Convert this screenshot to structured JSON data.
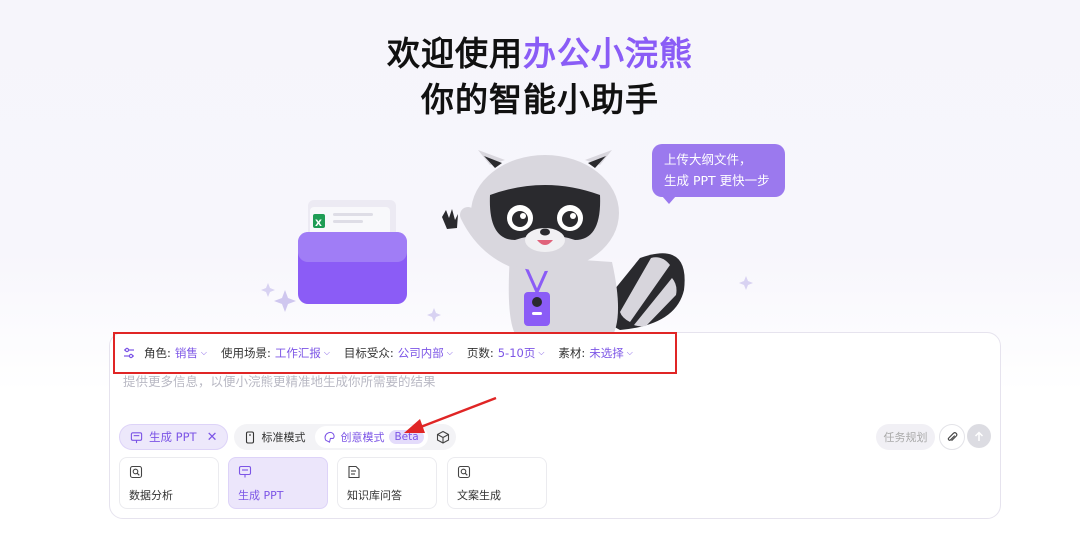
{
  "hero": {
    "title_prefix": "欢迎使用",
    "brand": "办公小浣熊",
    "subtitle": "你的智能小助手"
  },
  "bubble": {
    "line1": "上传大纲文件，",
    "line2": "生成 PPT 更快一步"
  },
  "attributes": [
    {
      "key": "角色:",
      "value": "销售"
    },
    {
      "key": "使用场景:",
      "value": "工作汇报"
    },
    {
      "key": "目标受众:",
      "value": "公司内部"
    },
    {
      "key": "页数:",
      "value": "5-10页"
    },
    {
      "key": "素材:",
      "value": "未选择"
    }
  ],
  "prompt_placeholder": "提供更多信息，以便小浣熊更精准地生成你所需要的结果",
  "chip": {
    "label": "生成 PPT"
  },
  "modes": {
    "standard": "标准模式",
    "creative": "创意模式",
    "beta": "Beta"
  },
  "actions": {
    "task_plan": "任务规划"
  },
  "cards": [
    {
      "label": "数据分析",
      "icon": "chart-search-icon",
      "active": false
    },
    {
      "label": "生成 PPT",
      "icon": "presentation-icon",
      "active": true
    },
    {
      "label": "知识库问答",
      "icon": "document-edit-icon",
      "active": false
    },
    {
      "label": "文案生成",
      "icon": "image-search-icon",
      "active": false
    }
  ],
  "colors": {
    "accent": "#7c55e6",
    "brand": "#8a5cf6",
    "highlight_box": "#e02525",
    "bubble": "#9b79ee"
  }
}
